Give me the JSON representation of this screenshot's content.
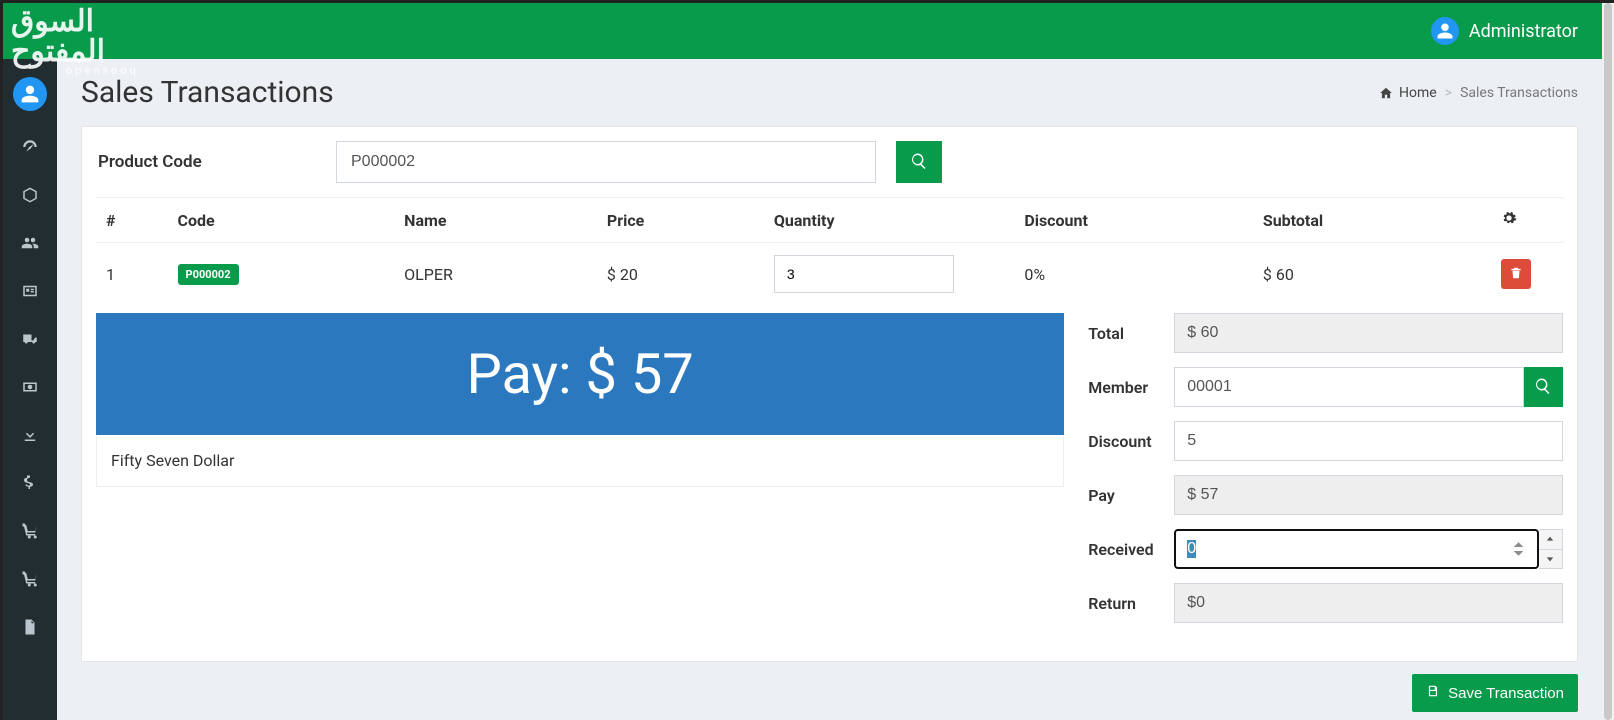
{
  "header": {
    "watermark_line1": "السوق المفتوح",
    "watermark_line2": "opensooq",
    "user_label": "Administrator"
  },
  "page": {
    "title": "Sales Transactions",
    "breadcrumb_home": "Home",
    "breadcrumb_page": "Sales Transactions"
  },
  "filter": {
    "label": "Product Code",
    "value": "P000002"
  },
  "table": {
    "headers": {
      "num": "#",
      "code": "Code",
      "name": "Name",
      "price": "Price",
      "qty": "Quantity",
      "discount": "Discount",
      "subtotal": "Subtotal"
    },
    "row": {
      "num": "1",
      "code": "P000002",
      "name": "OLPER",
      "price": "$ 20",
      "qty": "3",
      "discount": "0%",
      "subtotal": "$ 60"
    }
  },
  "pay": {
    "banner": "Pay: $ 57",
    "words": "Fifty Seven Dollar"
  },
  "summary": {
    "labels": {
      "total": "Total",
      "member": "Member",
      "discount": "Discount",
      "pay": "Pay",
      "received": "Received",
      "return": "Return"
    },
    "values": {
      "total": "$ 60",
      "member": "00001",
      "discount": "5",
      "pay": "$ 57",
      "received": "0",
      "return": "$0"
    }
  },
  "actions": {
    "save": "Save Transaction"
  }
}
